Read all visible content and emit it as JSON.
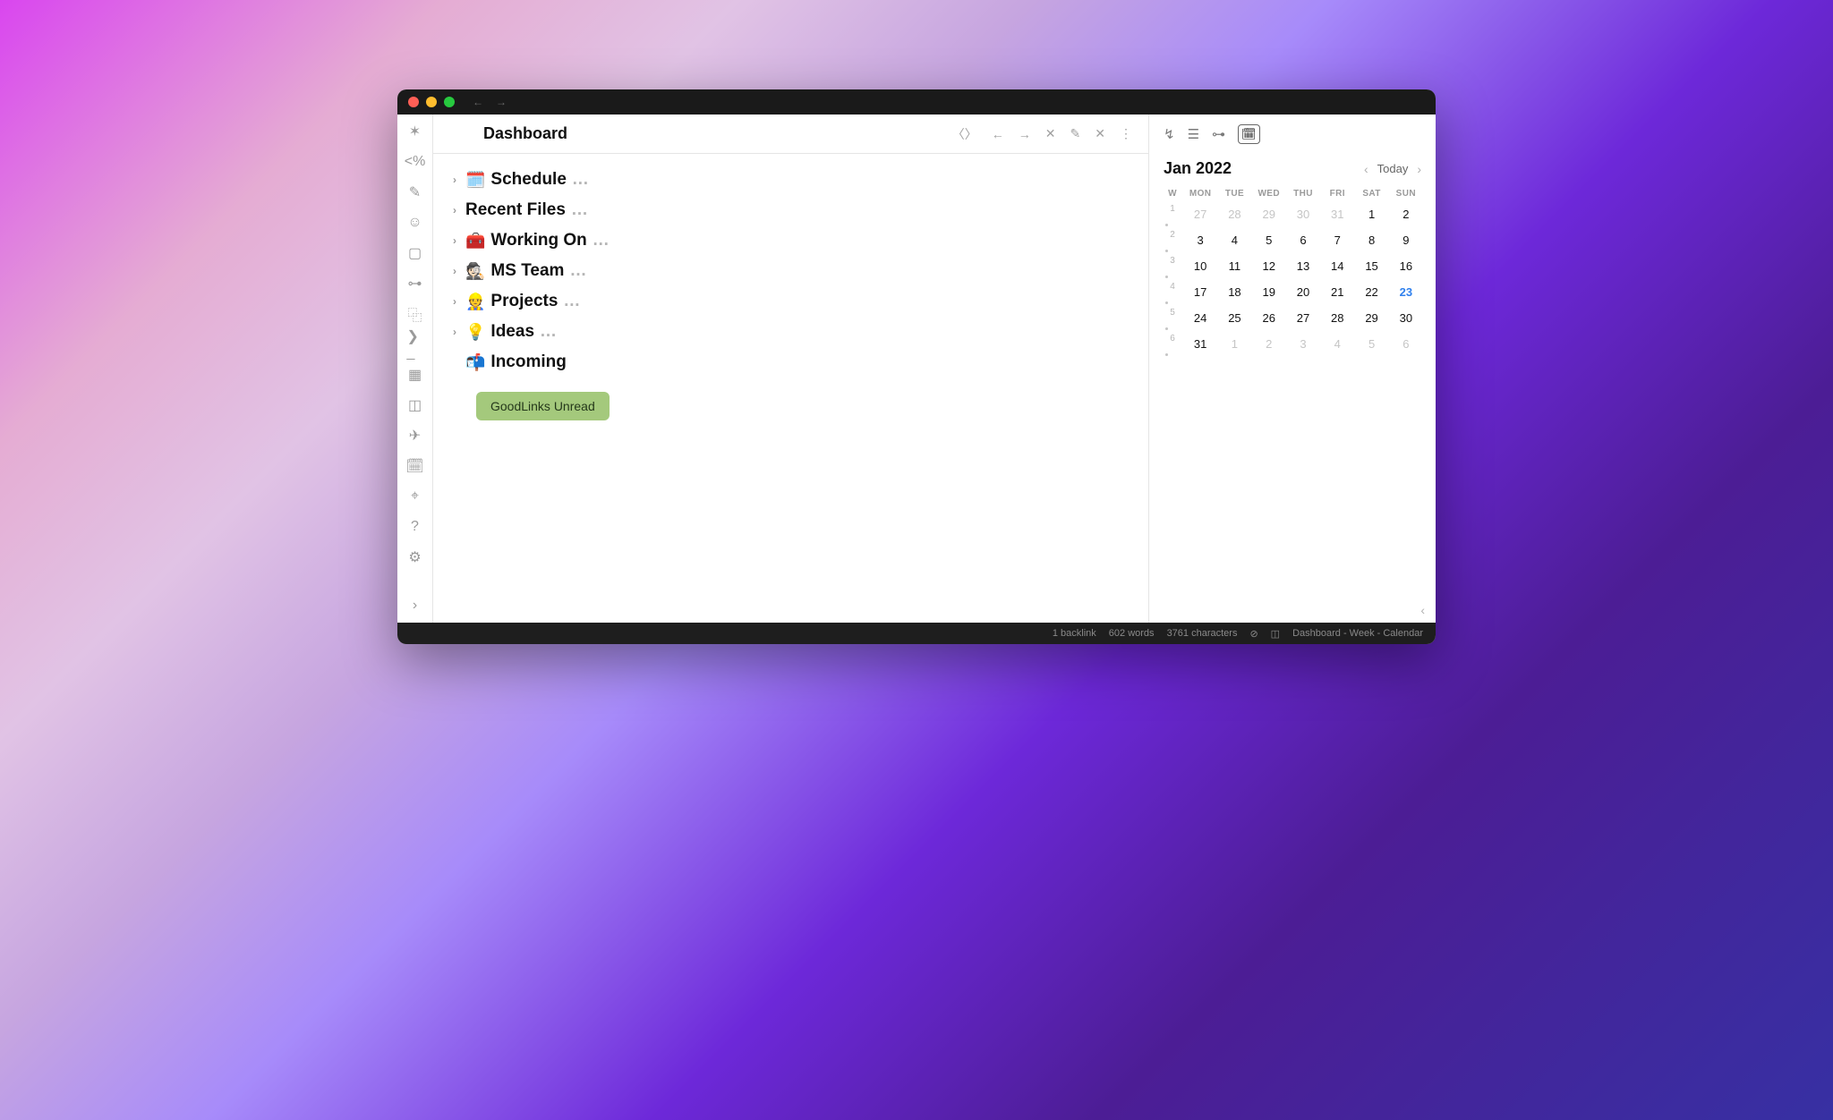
{
  "header": {
    "title": "Dashboard"
  },
  "outline": {
    "items": [
      {
        "emoji": "🗓️",
        "label": "Schedule",
        "has_children": true
      },
      {
        "emoji": "",
        "label": "Recent Files",
        "has_children": true
      },
      {
        "emoji": "🧰",
        "label": "Working On",
        "has_children": true
      },
      {
        "emoji": "🕵🏻",
        "label": "MS Team",
        "has_children": true
      },
      {
        "emoji": "👷",
        "label": "Projects",
        "has_children": true
      },
      {
        "emoji": "💡",
        "label": "Ideas",
        "has_children": true
      },
      {
        "emoji": "📬",
        "label": "Incoming",
        "has_children": false
      }
    ],
    "button_label": "GoodLinks Unread"
  },
  "calendar": {
    "month_label": "Jan 2022",
    "today_label": "Today",
    "dow": [
      "W",
      "MON",
      "TUE",
      "WED",
      "THU",
      "FRI",
      "SAT",
      "SUN"
    ],
    "weeks": [
      {
        "wk": "1",
        "days": [
          {
            "d": "27",
            "other": true
          },
          {
            "d": "28",
            "other": true
          },
          {
            "d": "29",
            "other": true
          },
          {
            "d": "30",
            "other": true
          },
          {
            "d": "31",
            "other": true
          },
          {
            "d": "1"
          },
          {
            "d": "2"
          }
        ]
      },
      {
        "wk": "2",
        "days": [
          {
            "d": "3"
          },
          {
            "d": "4"
          },
          {
            "d": "5"
          },
          {
            "d": "6"
          },
          {
            "d": "7"
          },
          {
            "d": "8"
          },
          {
            "d": "9"
          }
        ]
      },
      {
        "wk": "3",
        "days": [
          {
            "d": "10"
          },
          {
            "d": "11"
          },
          {
            "d": "12"
          },
          {
            "d": "13"
          },
          {
            "d": "14"
          },
          {
            "d": "15"
          },
          {
            "d": "16"
          }
        ]
      },
      {
        "wk": "4",
        "days": [
          {
            "d": "17"
          },
          {
            "d": "18"
          },
          {
            "d": "19"
          },
          {
            "d": "20"
          },
          {
            "d": "21"
          },
          {
            "d": "22"
          },
          {
            "d": "23",
            "today": true
          }
        ]
      },
      {
        "wk": "5",
        "days": [
          {
            "d": "24"
          },
          {
            "d": "25"
          },
          {
            "d": "26"
          },
          {
            "d": "27"
          },
          {
            "d": "28"
          },
          {
            "d": "29"
          },
          {
            "d": "30"
          }
        ]
      },
      {
        "wk": "6",
        "days": [
          {
            "d": "31"
          },
          {
            "d": "1",
            "other": true
          },
          {
            "d": "2",
            "other": true
          },
          {
            "d": "3",
            "other": true
          },
          {
            "d": "4",
            "other": true
          },
          {
            "d": "5",
            "other": true
          },
          {
            "d": "6",
            "other": true
          }
        ]
      }
    ]
  },
  "statusbar": {
    "backlinks": "1 backlink",
    "words": "602 words",
    "chars": "3761 characters",
    "breadcrumb": "Dashboard - Week - Calendar"
  }
}
